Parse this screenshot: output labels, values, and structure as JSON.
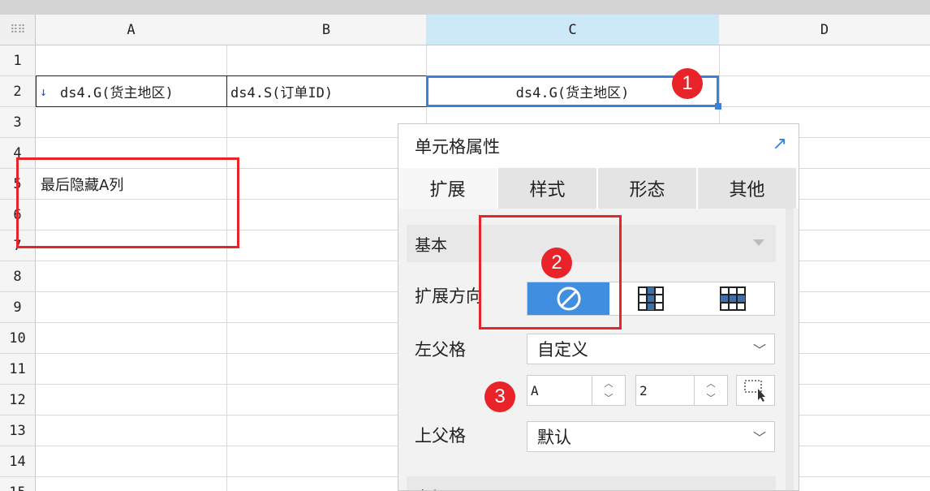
{
  "columns": [
    "A",
    "B",
    "C",
    "D"
  ],
  "rows": [
    "1",
    "2",
    "3",
    "4",
    "5",
    "6",
    "7",
    "8",
    "9",
    "10",
    "11",
    "12",
    "13",
    "14",
    "15"
  ],
  "cells": {
    "a2": "ds4.G(货主地区)",
    "b2": "ds4.S(订单ID)",
    "c2": "ds4.G(货主地区)",
    "a5": "最后隐藏A列"
  },
  "badges": [
    "1",
    "2",
    "3"
  ],
  "panel": {
    "title": "单元格属性",
    "tabs": [
      "扩展",
      "样式",
      "形态",
      "其他"
    ],
    "section_basic": "基本",
    "expand_direction_label": "扩展方向",
    "left_parent_label": "左父格",
    "left_parent_value": "自定义",
    "left_parent_col": "A",
    "left_parent_row": "2",
    "top_parent_label": "上父格",
    "top_parent_value": "默认",
    "next_section": "高级"
  },
  "colors": {
    "selection": "#3b82d6",
    "annotation": "#e8232a",
    "active_option": "#3f8ee0"
  }
}
